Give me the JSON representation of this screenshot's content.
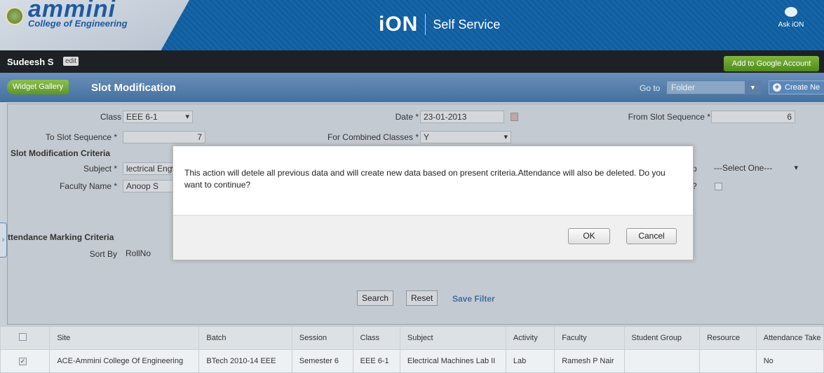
{
  "header": {
    "logo_name": "ammini",
    "logo_sub": "College of Engineering",
    "brand": "iON",
    "product": "Self Service",
    "ask": "Ask iON"
  },
  "userbar": {
    "username": "Sudeesh S",
    "edit": "edit",
    "google": "Add to Google Account"
  },
  "titlebar": {
    "widget_gallery": "Widget Gallery",
    "title": "Slot Modification",
    "goto_label": "Go to",
    "goto_value": "Folder",
    "create": "Create Ne"
  },
  "form": {
    "class_label": "Class *",
    "class_value": "EEE 6-1",
    "date_label": "Date *",
    "date_value": "23-01-2013",
    "from_slot_label": "From Slot Sequence *",
    "from_slot_value": "6",
    "to_slot_label": "To Slot Sequence *",
    "to_slot_value": "7",
    "combined_label": "For Combined Classes *",
    "combined_value": "Y",
    "section_slot": "Slot Modification Criteria",
    "subject_label": "Subject *",
    "subject_value": "lectrical Engi",
    "group_label_tail": "p",
    "group_value": "---Select One---",
    "faculty_label": "Faculty Name *",
    "faculty_value": "Anoop S",
    "question_tail": "?",
    "section_attendance": "ttendance Marking Criteria",
    "sortby_label": "Sort By",
    "sortby_value": "RollNo",
    "search": "Search",
    "reset": "Reset",
    "save_filter": "Save Filter"
  },
  "modal": {
    "message": "This action will detele all previous data and will create new data based on present criteria.Attendance will also be deleted. Do you want to continue?",
    "ok": "OK",
    "cancel": "Cancel"
  },
  "table": {
    "headers": [
      "Site",
      "Batch",
      "Session",
      "Class",
      "Subject",
      "Activity",
      "Faculty",
      "Student Group",
      "Resource",
      "Attendance Take"
    ],
    "rows": [
      [
        "ACE-Ammini College Of Engineering",
        "BTech 2010-14 EEE",
        "Semester 6",
        "EEE 6-1",
        "Electrical Machines Lab II",
        "Lab",
        "Ramesh P Nair",
        "",
        "",
        "No"
      ]
    ],
    "row_checked": true
  }
}
